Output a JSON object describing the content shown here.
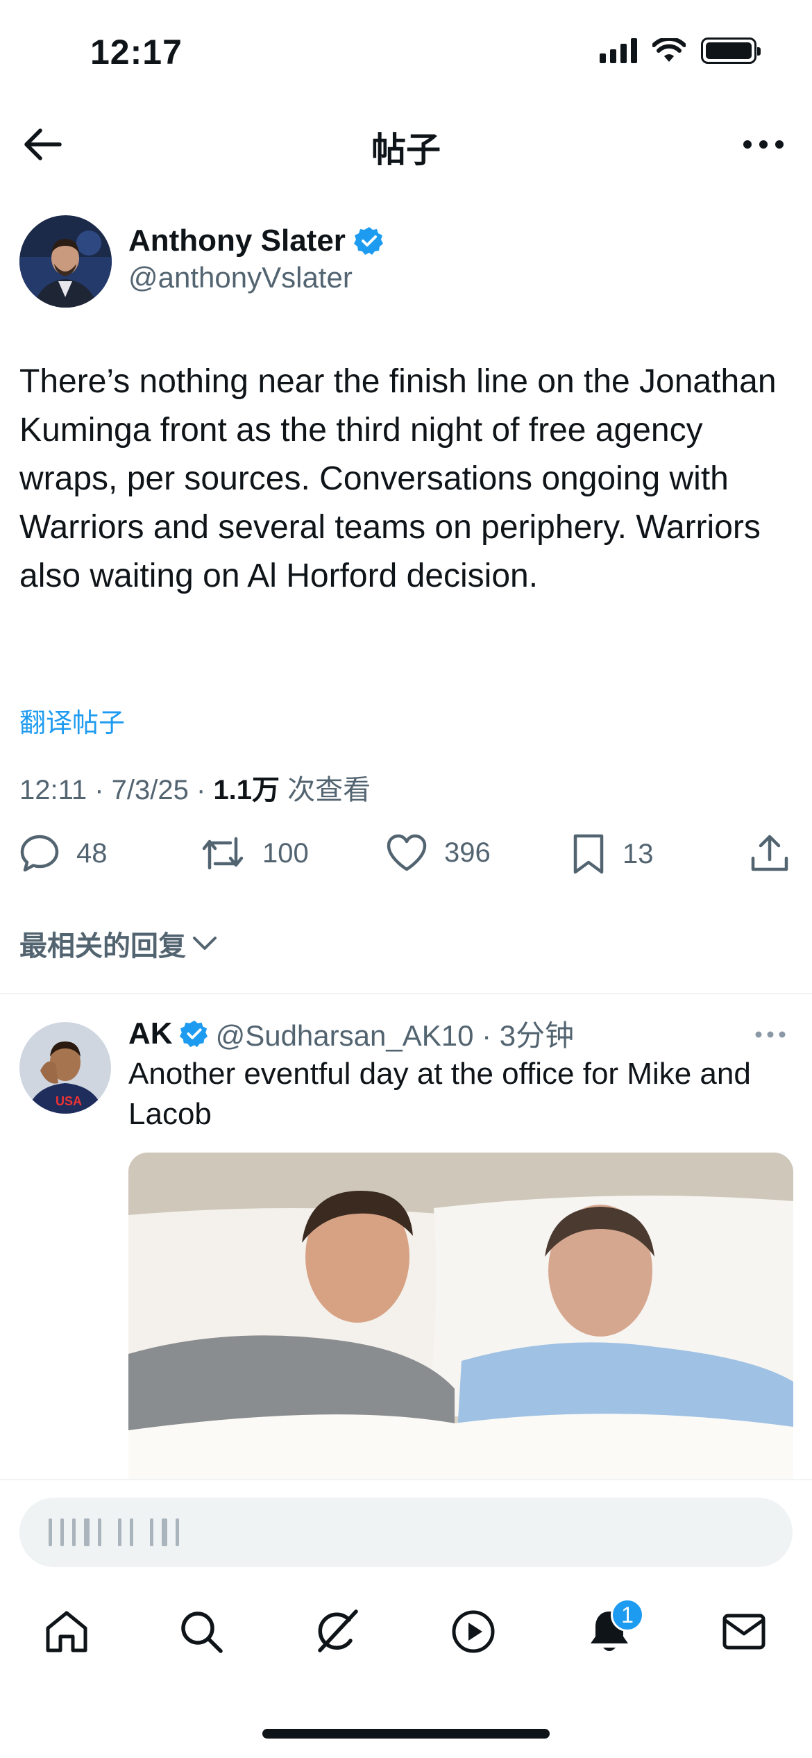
{
  "status_bar": {
    "time": "12:17"
  },
  "header": {
    "title": "帖子"
  },
  "post": {
    "author_name": "Anthony Slater",
    "author_handle": "@anthonyVslater",
    "text": "There’s nothing near the finish line on the Jonathan Kuminga front as the third night of free agency wraps, per sources. Conversations ongoing with Warriors and several teams on periphery. Warriors also waiting on Al Horford decision.",
    "translate_label": "翻译帖子",
    "time": "12:11 · 7/3/25 · ",
    "views_count": "1.1万",
    "views_label": " 次查看",
    "replies": "48",
    "reposts": "100",
    "likes": "396",
    "bookmarks": "13"
  },
  "replies_sort_label": "最相关的回复",
  "reply": {
    "author_name": "AK",
    "author_handle": "@Sudharsan_AK10 · 3分钟",
    "text": "Another eventful day at the office for Mike and Lacob"
  },
  "tab_bar": {
    "notifications_badge": "1"
  },
  "colors": {
    "accent": "#1d9bf0",
    "text": "#0f1419",
    "secondary": "#536471"
  }
}
